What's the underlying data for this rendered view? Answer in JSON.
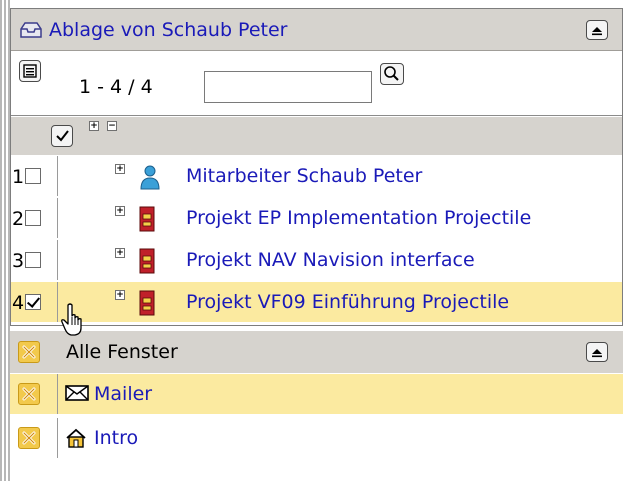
{
  "ablage": {
    "title": "Ablage von Schaub Peter",
    "range_label": "1 - 4 / 4",
    "search": {
      "value": "",
      "placeholder": ""
    },
    "items": [
      {
        "num": "1",
        "label": "Mitarbeiter Schaub Peter",
        "icon": "person-icon",
        "checked": false,
        "selected": false
      },
      {
        "num": "2",
        "label": "Projekt EP Implementation Projectile",
        "icon": "project-binder-icon",
        "checked": false,
        "selected": false
      },
      {
        "num": "3",
        "label": "Projekt NAV Navision interface",
        "icon": "project-binder-icon",
        "checked": false,
        "selected": false
      },
      {
        "num": "4",
        "label": "Projekt VF09 Einführung Projectile",
        "icon": "project-binder-icon",
        "checked": true,
        "selected": true
      }
    ]
  },
  "windows": {
    "title": "Alle Fenster",
    "items": [
      {
        "label": "Mailer",
        "icon": "envelope-icon",
        "selected": true
      },
      {
        "label": "Intro",
        "icon": "home-icon",
        "selected": false
      }
    ]
  },
  "colors": {
    "header_bg": "#d6d3ce",
    "link": "#1a1ab8",
    "selected_row": "#fbeaa0",
    "close_button": "#f2c94c"
  }
}
